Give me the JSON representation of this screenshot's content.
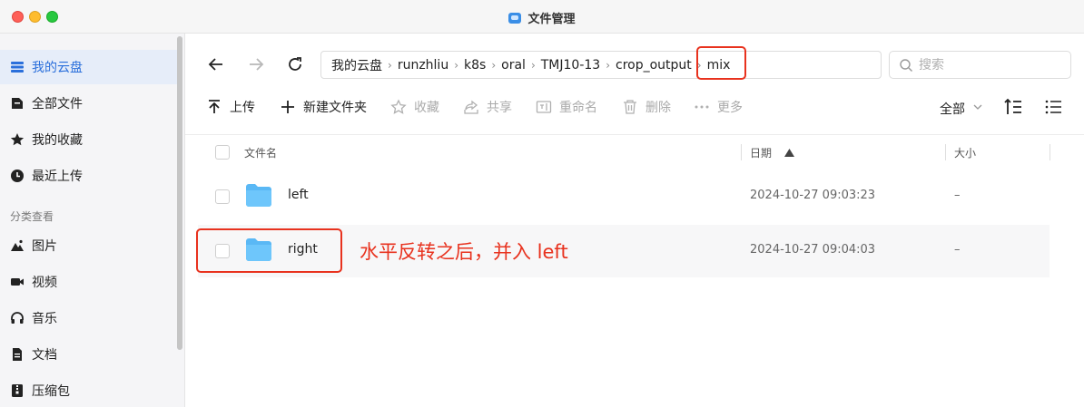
{
  "window": {
    "title": "文件管理"
  },
  "sidebar": {
    "items": [
      {
        "label": "我的云盘",
        "icon": "cloud-drive-icon",
        "active": true
      },
      {
        "label": "全部文件",
        "icon": "file-icon"
      },
      {
        "label": "我的收藏",
        "icon": "star-icon"
      },
      {
        "label": "最近上传",
        "icon": "clock-icon"
      }
    ],
    "section_label": "分类查看",
    "categories": [
      {
        "label": "图片",
        "icon": "image-icon"
      },
      {
        "label": "视频",
        "icon": "video-icon"
      },
      {
        "label": "音乐",
        "icon": "headphones-icon"
      },
      {
        "label": "文档",
        "icon": "document-icon"
      },
      {
        "label": "压缩包",
        "icon": "archive-icon"
      }
    ]
  },
  "breadcrumb": [
    "我的云盘",
    "runzhliu",
    "k8s",
    "oral",
    "TMJ10-13",
    "crop_output",
    "mix"
  ],
  "search": {
    "placeholder": "搜索"
  },
  "toolbar": {
    "upload": "上传",
    "new_folder": "新建文件夹",
    "favorite": "收藏",
    "share": "共享",
    "rename": "重命名",
    "delete": "删除",
    "more": "更多",
    "filter": "全部"
  },
  "table": {
    "columns": {
      "name": "文件名",
      "date": "日期",
      "size": "大小"
    },
    "rows": [
      {
        "name": "left",
        "date": "2024-10-27 09:03:23",
        "size": "–"
      },
      {
        "name": "right",
        "date": "2024-10-27 09:04:03",
        "size": "–"
      }
    ]
  },
  "annotation": {
    "text": "水平反转之后，并入 left",
    "color": "#e8321e"
  },
  "colors": {
    "accent": "#2a6fdb",
    "folder": "#5ab8f5",
    "annotation": "#e8321e"
  }
}
